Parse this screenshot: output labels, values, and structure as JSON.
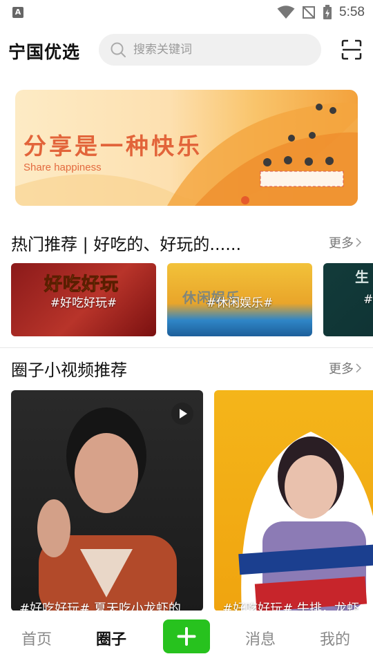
{
  "status_bar": {
    "left_icon": "A",
    "time": "5:58",
    "icons": [
      "wifi-icon",
      "no-signal-icon",
      "battery-charging-icon"
    ]
  },
  "header": {
    "app_title": "宁国优选",
    "search_placeholder": "搜索关键词",
    "scan_icon": "scan-icon"
  },
  "banner": {
    "title": "分享是一种快乐",
    "subtitle": "Share happiness"
  },
  "hot_section": {
    "title": "热门推荐 | 好吃的、好玩的......",
    "more_label": "更多",
    "topics": [
      {
        "label": "#好吃好玩#",
        "deco": "好吃好玩"
      },
      {
        "label": "#休闲娱乐#",
        "deco": "休闲娱乐"
      },
      {
        "label": "#",
        "deco": "生"
      }
    ]
  },
  "video_section": {
    "title": "圈子小视频推荐",
    "more_label": "更多",
    "videos": [
      {
        "caption": "#好吃好玩# 夏天吃小龙虾的"
      },
      {
        "caption": "#好吃好玩# 牛排，龙虾"
      }
    ]
  },
  "bottom_nav": {
    "items": [
      "首页",
      "圈子",
      "消息",
      "我的"
    ],
    "active": "圈子",
    "add_label": "+"
  },
  "colors": {
    "accent_green": "#27c21e",
    "banner_title": "#e2643a"
  }
}
